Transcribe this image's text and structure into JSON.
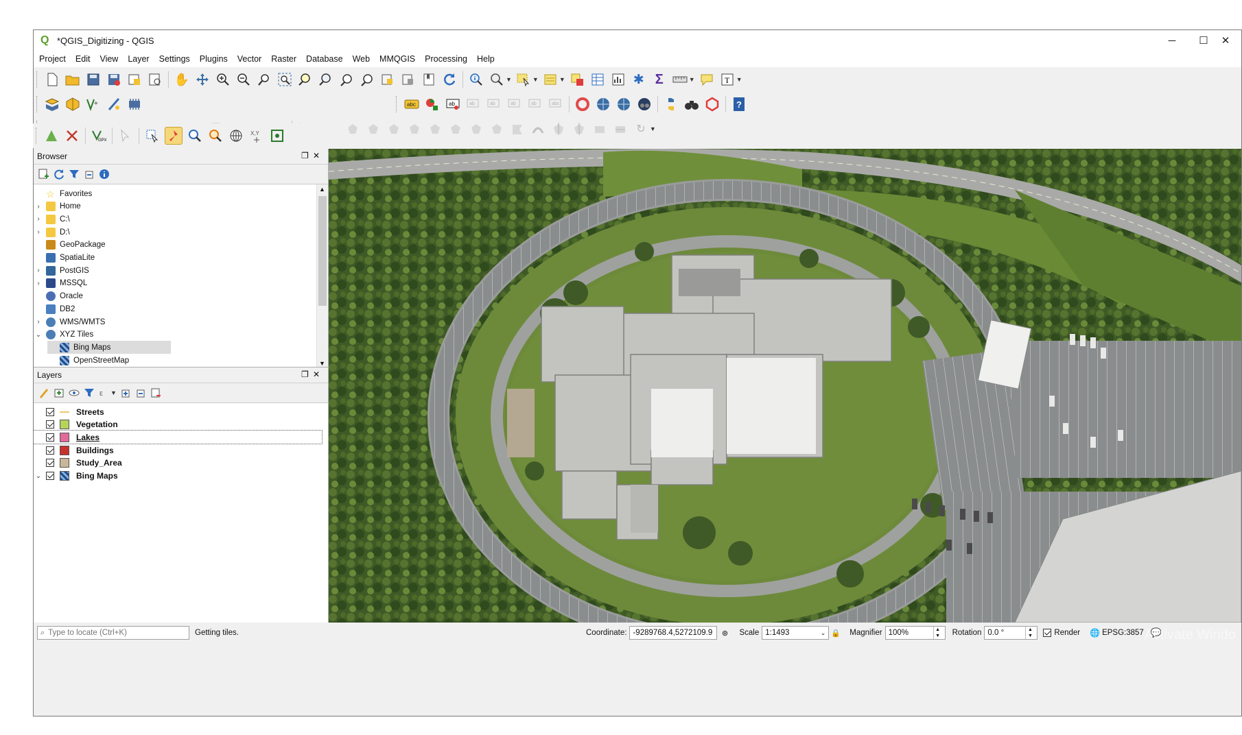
{
  "window": {
    "title": "*QGIS_Digitizing - QGIS",
    "controls": [
      "─",
      "☐",
      "✕"
    ]
  },
  "menu": [
    "Project",
    "Edit",
    "View",
    "Layer",
    "Settings",
    "Plugins",
    "Vector",
    "Raster",
    "Database",
    "Web",
    "MMQGIS",
    "Processing",
    "Help"
  ],
  "browser": {
    "title": "Browser",
    "items": [
      {
        "label": "Favorites",
        "icon": "star-icon",
        "expand": "",
        "color": "#f0c419"
      },
      {
        "label": "Home",
        "icon": "folder-icon",
        "expand": "›",
        "color": "#f5c842"
      },
      {
        "label": "C:\\",
        "icon": "folder-icon",
        "expand": "›",
        "color": "#f5c842"
      },
      {
        "label": "D:\\",
        "icon": "folder-icon",
        "expand": "›",
        "color": "#f5c842"
      },
      {
        "label": "GeoPackage",
        "icon": "geopackage-icon",
        "expand": "",
        "color": "#c98a1a"
      },
      {
        "label": "SpatiaLite",
        "icon": "spatialite-icon",
        "expand": "",
        "color": "#3a6fb0"
      },
      {
        "label": "PostGIS",
        "icon": "postgis-icon",
        "expand": "›",
        "color": "#33669a"
      },
      {
        "label": "MSSQL",
        "icon": "mssql-icon",
        "expand": "›",
        "color": "#2b4a8a"
      },
      {
        "label": "Oracle",
        "icon": "oracle-icon",
        "expand": "",
        "color": "#4a6eb5"
      },
      {
        "label": "DB2",
        "icon": "db2-icon",
        "expand": "",
        "color": "#4a7fc0"
      },
      {
        "label": "WMS/WMTS",
        "icon": "globe-icon",
        "expand": "›",
        "color": "#4a7fb5"
      },
      {
        "label": "XYZ Tiles",
        "icon": "globe-icon",
        "expand": "⌄",
        "color": "#4a7fb5"
      },
      {
        "label": "Bing Maps",
        "icon": "xyz-tile-icon",
        "expand": "",
        "color": "#1f4e8c",
        "child": true,
        "selected": true
      },
      {
        "label": "OpenStreetMap",
        "icon": "xyz-tile-icon",
        "expand": "",
        "color": "#1f4e8c",
        "child": true
      }
    ]
  },
  "layers": {
    "title": "Layers",
    "items": [
      {
        "label": "Streets",
        "color": "#f2c66b",
        "type": "line",
        "expand": ""
      },
      {
        "label": "Vegetation",
        "color": "#b6d35a",
        "type": "fill",
        "expand": ""
      },
      {
        "label": "Lakes",
        "color": "#e06a9a",
        "type": "fill",
        "expand": "",
        "selected": true
      },
      {
        "label": "Buildings",
        "color": "#c8322d",
        "type": "fill",
        "expand": ""
      },
      {
        "label": "Study_Area",
        "color": "#c9b79a",
        "type": "fill",
        "expand": ""
      },
      {
        "label": "Bing Maps",
        "color": "#1f4e8c",
        "type": "raster",
        "expand": "⌄"
      }
    ]
  },
  "status": {
    "locate_placeholder": "Type to locate (Ctrl+K)",
    "message": "Getting tiles.",
    "coordinate_label": "Coordinate:",
    "coordinate_value": "-9289768.4,5272109.9",
    "scale_label": "Scale",
    "scale_value": "1:1493",
    "magnifier_label": "Magnifier",
    "magnifier_value": "100%",
    "rotation_label": "Rotation",
    "rotation_value": "0.0 °",
    "render_label": "Render",
    "crs": "EPSG:3857",
    "watermark": "Activate Windo"
  }
}
